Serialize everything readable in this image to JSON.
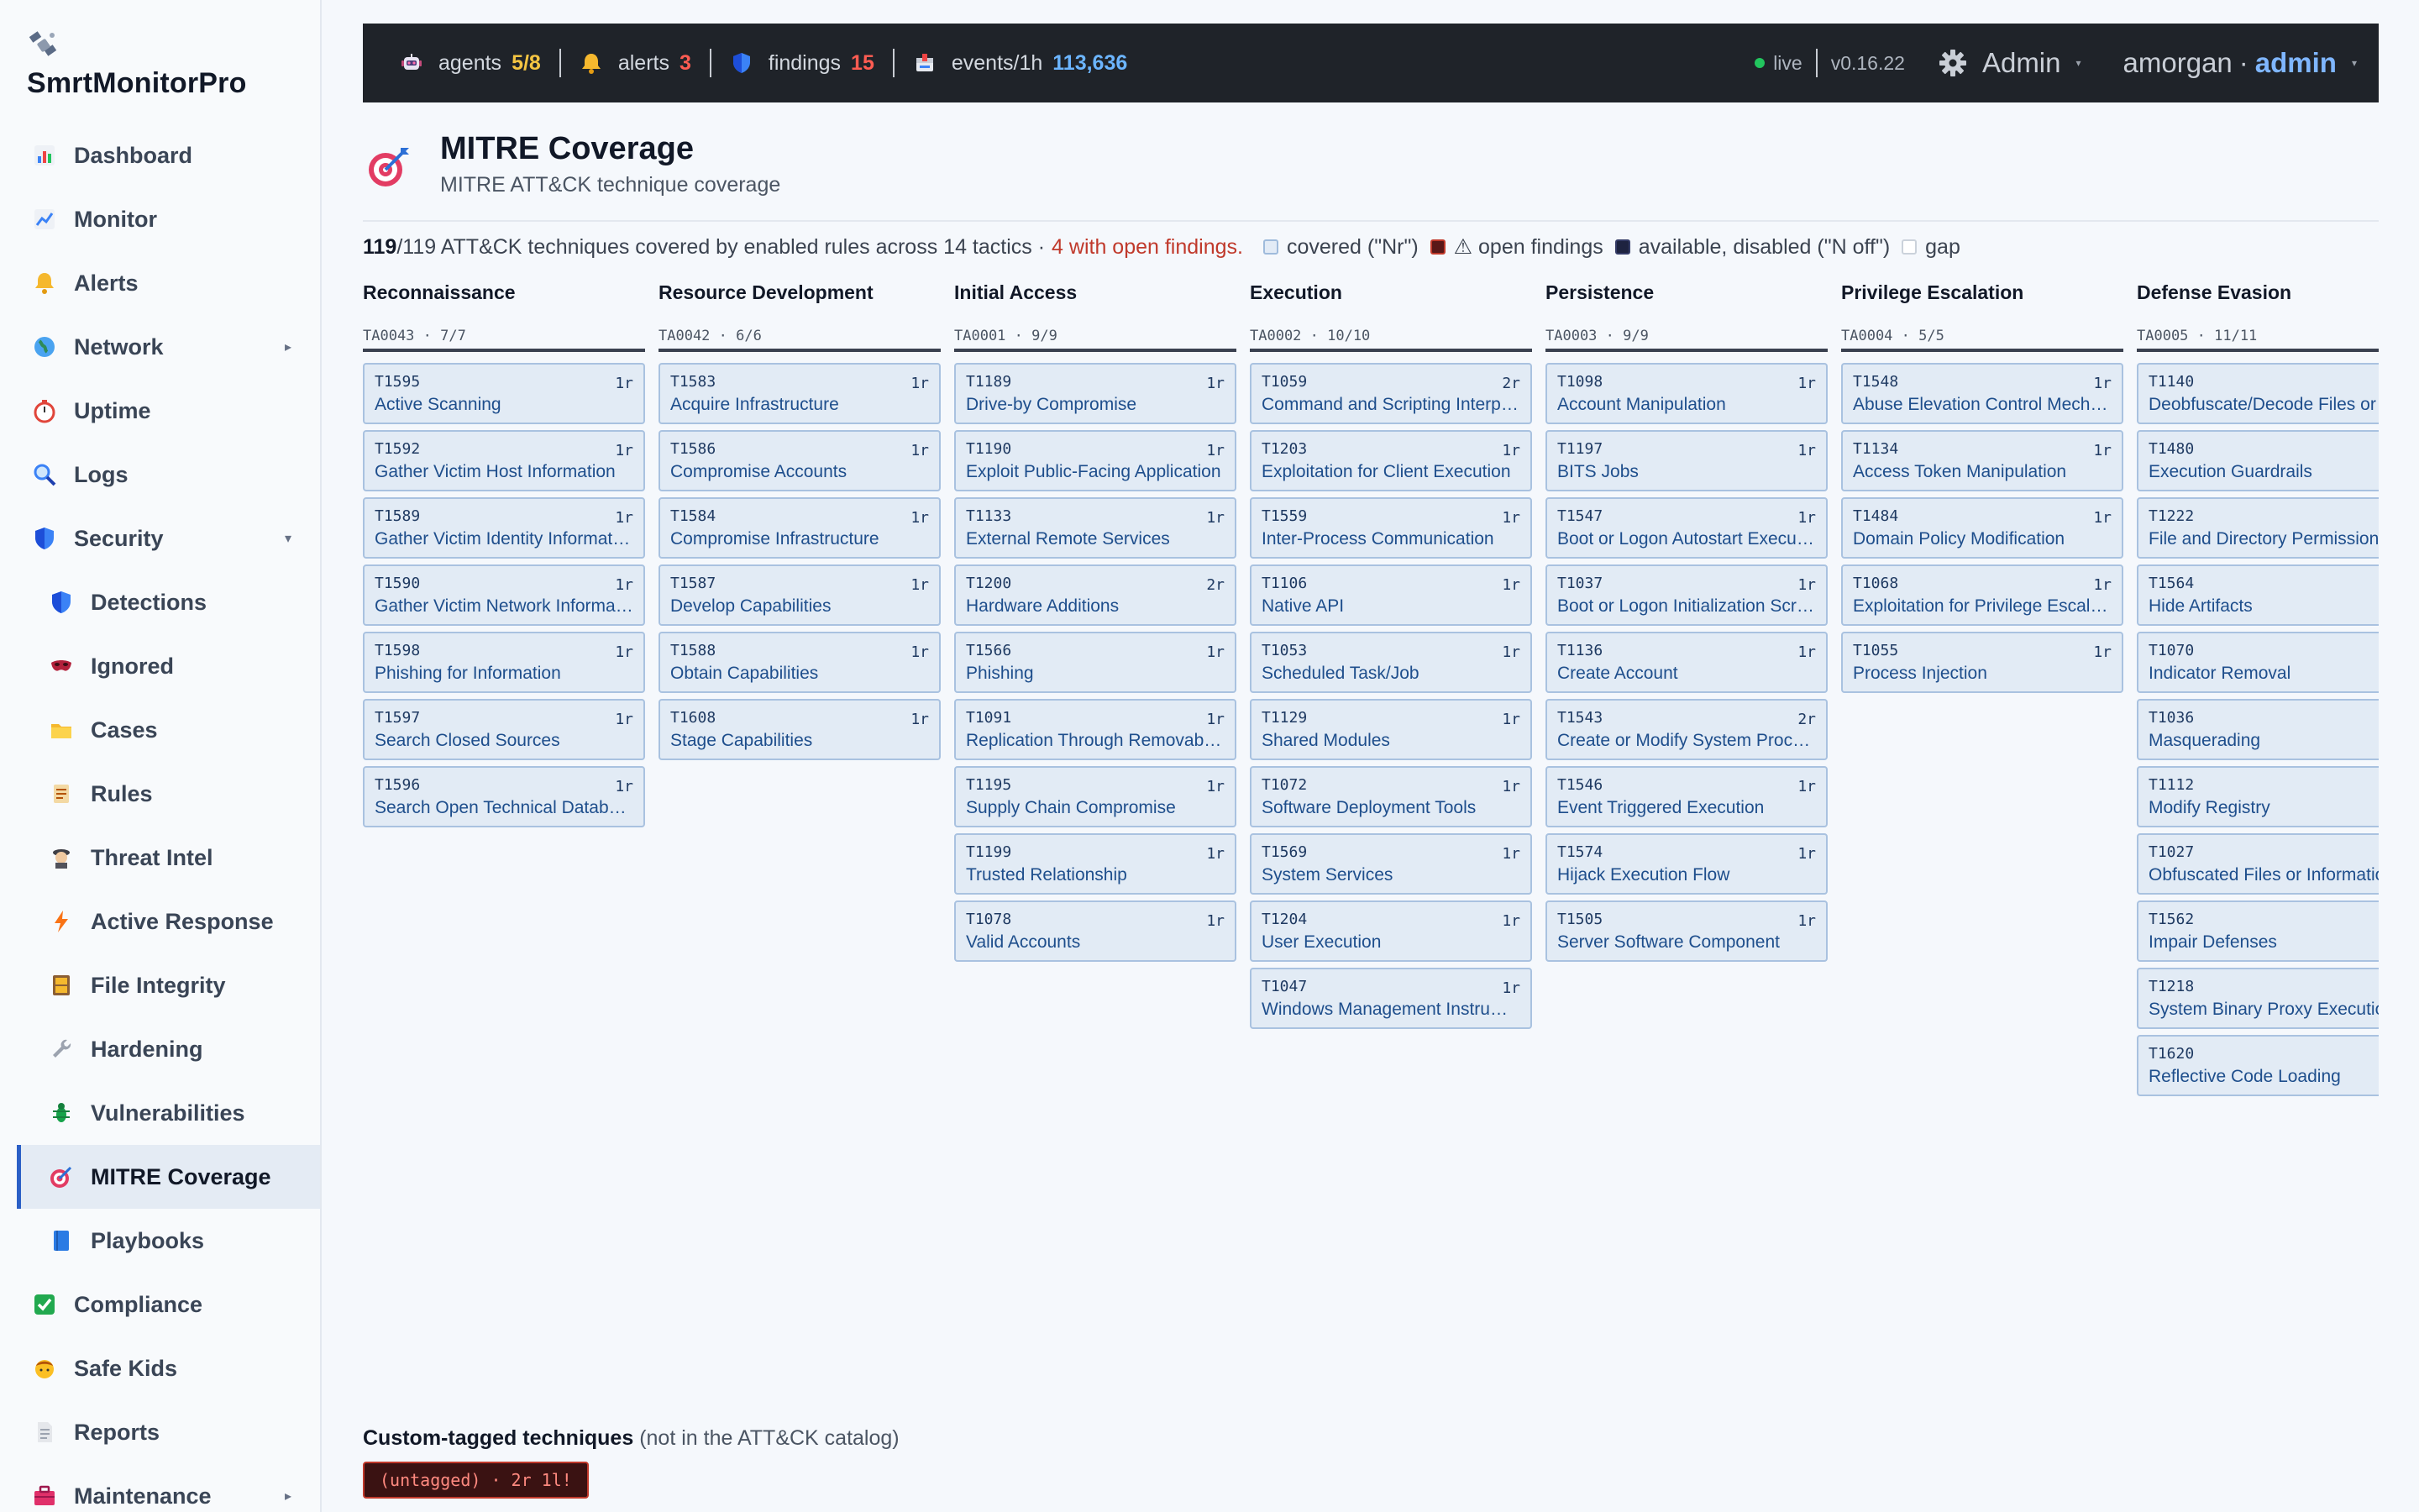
{
  "app": {
    "name": "SmrtMonitorPro"
  },
  "sidebar": {
    "items": [
      {
        "key": "dashboard",
        "label": "Dashboard",
        "icon": "bar-chart-icon",
        "sub": false
      },
      {
        "key": "monitor",
        "label": "Monitor",
        "icon": "line-chart-icon",
        "sub": false
      },
      {
        "key": "alerts",
        "label": "Alerts",
        "icon": "bell-icon",
        "sub": false
      },
      {
        "key": "network",
        "label": "Network",
        "icon": "globe-icon",
        "sub": false,
        "caret": "▸"
      },
      {
        "key": "uptime",
        "label": "Uptime",
        "icon": "stopwatch-icon",
        "sub": false
      },
      {
        "key": "logs",
        "label": "Logs",
        "icon": "magnifier-icon",
        "sub": false
      },
      {
        "key": "security",
        "label": "Security",
        "icon": "shield-icon",
        "sub": false,
        "caret": "▾"
      },
      {
        "key": "detections",
        "label": "Detections",
        "icon": "shield-icon",
        "sub": true
      },
      {
        "key": "ignored",
        "label": "Ignored",
        "icon": "mask-icon",
        "sub": true
      },
      {
        "key": "cases",
        "label": "Cases",
        "icon": "folder-icon",
        "sub": true
      },
      {
        "key": "rules",
        "label": "Rules",
        "icon": "scroll-icon",
        "sub": true
      },
      {
        "key": "threat-intel",
        "label": "Threat Intel",
        "icon": "detective-icon",
        "sub": true
      },
      {
        "key": "active-response",
        "label": "Active Response",
        "icon": "lightning-icon",
        "sub": true
      },
      {
        "key": "file-integrity",
        "label": "File Integrity",
        "icon": "file-cabinet-icon",
        "sub": true
      },
      {
        "key": "hardening",
        "label": "Hardening",
        "icon": "wrench-icon",
        "sub": true
      },
      {
        "key": "vulnerabilities",
        "label": "Vulnerabilities",
        "icon": "bug-icon",
        "sub": true
      },
      {
        "key": "mitre-coverage",
        "label": "MITRE Coverage",
        "icon": "target-icon",
        "sub": true,
        "active": true
      },
      {
        "key": "playbooks",
        "label": "Playbooks",
        "icon": "book-icon",
        "sub": true
      },
      {
        "key": "compliance",
        "label": "Compliance",
        "icon": "check-box-icon",
        "sub": false
      },
      {
        "key": "safe-kids",
        "label": "Safe Kids",
        "icon": "child-icon",
        "sub": false
      },
      {
        "key": "reports",
        "label": "Reports",
        "icon": "document-icon",
        "sub": false
      },
      {
        "key": "maintenance",
        "label": "Maintenance",
        "icon": "toolbox-icon",
        "sub": false,
        "caret": "▸"
      }
    ]
  },
  "topbar": {
    "agents_label": "agents",
    "agents_value": "5/8",
    "alerts_label": "alerts",
    "alerts_value": "3",
    "findings_label": "findings",
    "findings_value": "15",
    "events_label": "events/1h",
    "events_value": "113,636",
    "live": "live",
    "version": "v0.16.22",
    "role_button": "Admin",
    "username": "amorgan",
    "user_sep": "·",
    "user_role": "admin"
  },
  "page": {
    "title": "MITRE Coverage",
    "subtitle": "MITRE ATT&CK technique coverage"
  },
  "summary": {
    "covered_count": "119",
    "text": "/119 ATT&CK techniques covered by enabled rules across 14 tactics ·",
    "open_findings": "4 with open findings.",
    "legend_covered": "covered (\"Nr\")",
    "legend_open": "⚠ open findings",
    "legend_available": "available, disabled (\"N off\")",
    "legend_gap": "gap"
  },
  "tactics": [
    {
      "name": "Reconnaissance",
      "id": "TA0043 · 7/7",
      "techniques": [
        {
          "id": "T1595",
          "name": "Active Scanning",
          "rules": "1r"
        },
        {
          "id": "T1592",
          "name": "Gather Victim Host Information",
          "rules": "1r"
        },
        {
          "id": "T1589",
          "name": "Gather Victim Identity Informat…",
          "rules": "1r"
        },
        {
          "id": "T1590",
          "name": "Gather Victim Network Informa…",
          "rules": "1r"
        },
        {
          "id": "T1598",
          "name": "Phishing for Information",
          "rules": "1r"
        },
        {
          "id": "T1597",
          "name": "Search Closed Sources",
          "rules": "1r"
        },
        {
          "id": "T1596",
          "name": "Search Open Technical Databas…",
          "rules": "1r"
        }
      ]
    },
    {
      "name": "Resource Development",
      "id": "TA0042 · 6/6",
      "techniques": [
        {
          "id": "T1583",
          "name": "Acquire Infrastructure",
          "rules": "1r"
        },
        {
          "id": "T1586",
          "name": "Compromise Accounts",
          "rules": "1r"
        },
        {
          "id": "T1584",
          "name": "Compromise Infrastructure",
          "rules": "1r"
        },
        {
          "id": "T1587",
          "name": "Develop Capabilities",
          "rules": "1r"
        },
        {
          "id": "T1588",
          "name": "Obtain Capabilities",
          "rules": "1r"
        },
        {
          "id": "T1608",
          "name": "Stage Capabilities",
          "rules": "1r"
        }
      ]
    },
    {
      "name": "Initial Access",
      "id": "TA0001 · 9/9",
      "techniques": [
        {
          "id": "T1189",
          "name": "Drive-by Compromise",
          "rules": "1r"
        },
        {
          "id": "T1190",
          "name": "Exploit Public-Facing Application",
          "rules": "1r"
        },
        {
          "id": "T1133",
          "name": "External Remote Services",
          "rules": "1r"
        },
        {
          "id": "T1200",
          "name": "Hardware Additions",
          "rules": "2r"
        },
        {
          "id": "T1566",
          "name": "Phishing",
          "rules": "1r"
        },
        {
          "id": "T1091",
          "name": "Replication Through Removabl…",
          "rules": "1r"
        },
        {
          "id": "T1195",
          "name": "Supply Chain Compromise",
          "rules": "1r"
        },
        {
          "id": "T1199",
          "name": "Trusted Relationship",
          "rules": "1r"
        },
        {
          "id": "T1078",
          "name": "Valid Accounts",
          "rules": "1r"
        }
      ]
    },
    {
      "name": "Execution",
      "id": "TA0002 · 10/10",
      "techniques": [
        {
          "id": "T1059",
          "name": "Command and Scripting Interp…",
          "rules": "2r"
        },
        {
          "id": "T1203",
          "name": "Exploitation for Client Execution",
          "rules": "1r"
        },
        {
          "id": "T1559",
          "name": "Inter-Process Communication",
          "rules": "1r"
        },
        {
          "id": "T1106",
          "name": "Native API",
          "rules": "1r"
        },
        {
          "id": "T1053",
          "name": "Scheduled Task/Job",
          "rules": "1r"
        },
        {
          "id": "T1129",
          "name": "Shared Modules",
          "rules": "1r"
        },
        {
          "id": "T1072",
          "name": "Software Deployment Tools",
          "rules": "1r"
        },
        {
          "id": "T1569",
          "name": "System Services",
          "rules": "1r"
        },
        {
          "id": "T1204",
          "name": "User Execution",
          "rules": "1r"
        },
        {
          "id": "T1047",
          "name": "Windows Management Instrum…",
          "rules": "1r"
        }
      ]
    },
    {
      "name": "Persistence",
      "id": "TA0003 · 9/9",
      "techniques": [
        {
          "id": "T1098",
          "name": "Account Manipulation",
          "rules": "1r"
        },
        {
          "id": "T1197",
          "name": "BITS Jobs",
          "rules": "1r"
        },
        {
          "id": "T1547",
          "name": "Boot or Logon Autostart Execut…",
          "rules": "1r"
        },
        {
          "id": "T1037",
          "name": "Boot or Logon Initialization Scri…",
          "rules": "1r"
        },
        {
          "id": "T1136",
          "name": "Create Account",
          "rules": "1r"
        },
        {
          "id": "T1543",
          "name": "Create or Modify System Process",
          "rules": "2r"
        },
        {
          "id": "T1546",
          "name": "Event Triggered Execution",
          "rules": "1r"
        },
        {
          "id": "T1574",
          "name": "Hijack Execution Flow",
          "rules": "1r"
        },
        {
          "id": "T1505",
          "name": "Server Software Component",
          "rules": "1r"
        }
      ]
    },
    {
      "name": "Privilege Escalation",
      "id": "TA0004 · 5/5",
      "techniques": [
        {
          "id": "T1548",
          "name": "Abuse Elevation Control Mecha…",
          "rules": "1r"
        },
        {
          "id": "T1134",
          "name": "Access Token Manipulation",
          "rules": "1r"
        },
        {
          "id": "T1484",
          "name": "Domain Policy Modification",
          "rules": "1r"
        },
        {
          "id": "T1068",
          "name": "Exploitation for Privilege Escala…",
          "rules": "1r"
        },
        {
          "id": "T1055",
          "name": "Process Injection",
          "rules": "1r"
        }
      ]
    },
    {
      "name": "Defense Evasion",
      "id": "TA0005 · 11/11",
      "techniques": [
        {
          "id": "T1140",
          "name": "Deobfuscate/Decode Files or Information",
          "rules": ""
        },
        {
          "id": "T1480",
          "name": "Execution Guardrails",
          "rules": ""
        },
        {
          "id": "T1222",
          "name": "File and Directory Permissions Modification",
          "rules": ""
        },
        {
          "id": "T1564",
          "name": "Hide Artifacts",
          "rules": ""
        },
        {
          "id": "T1070",
          "name": "Indicator Removal",
          "rules": ""
        },
        {
          "id": "T1036",
          "name": "Masquerading",
          "rules": ""
        },
        {
          "id": "T1112",
          "name": "Modify Registry",
          "rules": ""
        },
        {
          "id": "T1027",
          "name": "Obfuscated Files or Information",
          "rules": ""
        },
        {
          "id": "T1562",
          "name": "Impair Defenses",
          "rules": ""
        },
        {
          "id": "T1218",
          "name": "System Binary Proxy Execution",
          "rules": ""
        },
        {
          "id": "T1620",
          "name": "Reflective Code Loading",
          "rules": ""
        }
      ]
    }
  ],
  "custom": {
    "title": "Custom-tagged techniques",
    "note": "(not in the ATT&CK catalog)",
    "tag": "(untagged) · 2r 1l!"
  }
}
